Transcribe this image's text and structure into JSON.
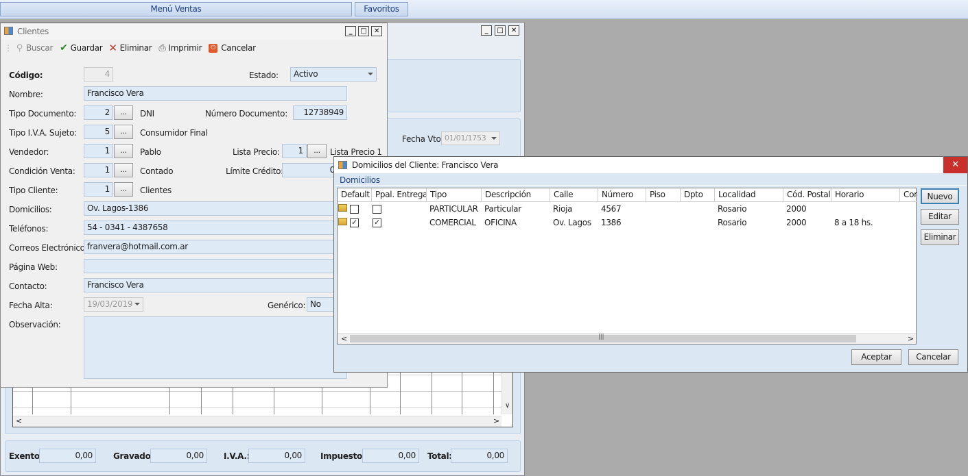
{
  "topbar": {
    "menu_ventas": "Menú Ventas",
    "favoritos": "Favoritos"
  },
  "bg_window": {
    "fecha_vto_label": "Fecha Vto.:",
    "fecha_vto_value": "01/01/1753"
  },
  "totals": {
    "exento_label": "Exento:",
    "exento_value": "0,00",
    "gravado_label": "Gravado:",
    "gravado_value": "0,00",
    "iva_label": "I.V.A.:",
    "iva_value": "0,00",
    "impuestos_label": "Impuestos:",
    "impuestos_value": "0,00",
    "total_label": "Total:",
    "total_value": "0,00"
  },
  "clientes": {
    "title": "Clientes",
    "toolbar": {
      "buscar": "Buscar",
      "guardar": "Guardar",
      "eliminar": "Eliminar",
      "imprimir": "Imprimir",
      "cancelar": "Cancelar"
    },
    "codigo_label": "Código:",
    "codigo_value": "4",
    "estado_label": "Estado:",
    "estado_value": "Activo",
    "nombre_label": "Nombre:",
    "nombre_value": "Francisco Vera",
    "tipo_doc_label": "Tipo Documento:",
    "tipo_doc_value": "2",
    "tipo_doc_desc": "DNI",
    "num_doc_label": "Número Documento:",
    "num_doc_value": "12738949",
    "tipo_iva_label": "Tipo I.V.A. Sujeto:",
    "tipo_iva_value": "5",
    "tipo_iva_desc": "Consumidor Final",
    "vendedor_label": "Vendedor:",
    "vendedor_value": "1",
    "vendedor_desc": "Pablo",
    "lista_precio_label": "Lista Precio:",
    "lista_precio_value": "1",
    "lista_precio_desc": "Lista Precio 1",
    "cond_venta_label": "Condición Venta:",
    "cond_venta_value": "1",
    "cond_venta_desc": "Contado",
    "limite_label": "Límite Crédito:",
    "limite_value": "0",
    "tipo_cliente_label": "Tipo Cliente:",
    "tipo_cliente_value": "1",
    "tipo_cliente_desc": "Clientes",
    "domicilios_label": "Domicilios:",
    "domicilios_value": "Ov. Lagos-1386",
    "telefonos_label": "Teléfonos:",
    "telefonos_value": "54 - 0341 - 4387658",
    "correos_label": "Correos Electrónicos:",
    "correos_value": "franvera@hotmail.com.ar",
    "web_label": "Página Web:",
    "web_value": "",
    "contacto_label": "Contacto:",
    "contacto_value": "Francisco Vera",
    "fecha_alta_label": "Fecha Alta:",
    "fecha_alta_value": "19/03/2019",
    "generico_label": "Genérico:",
    "generico_value": "No",
    "observacion_label": "Observación:",
    "observacion_value": "",
    "dots": "..."
  },
  "domicilios_dialog": {
    "title": "Domicilios del Cliente: Francisco Vera",
    "group_label": "Domicilios",
    "columns": [
      "Default",
      "Ppal. Entrega",
      "Tipo",
      "Descripción",
      "Calle",
      "Número",
      "Piso",
      "Dpto",
      "Localidad",
      "Cód. Postal",
      "Horario",
      "Cor"
    ],
    "rows": [
      {
        "default": false,
        "ppal": false,
        "tipo": "PARTICULAR",
        "descripcion": "Particular",
        "calle": "Rioja",
        "numero": "4567",
        "piso": "",
        "dpto": "",
        "localidad": "Rosario",
        "cp": "2000",
        "horario": ""
      },
      {
        "default": true,
        "ppal": true,
        "tipo": "COMERCIAL",
        "descripcion": "OFICINA",
        "calle": "Ov. Lagos",
        "numero": "1386",
        "piso": "",
        "dpto": "",
        "localidad": "Rosario",
        "cp": "2000",
        "horario": "8 a 18 hs."
      }
    ],
    "buttons": {
      "nuevo": "Nuevo",
      "editar": "Editar",
      "eliminar": "Eliminar",
      "aceptar": "Aceptar",
      "cancelar": "Cancelar"
    }
  },
  "colors": {
    "accent": "#1e3f7a",
    "field_bg": "#dfeaf7",
    "close_red": "#c0392b"
  }
}
